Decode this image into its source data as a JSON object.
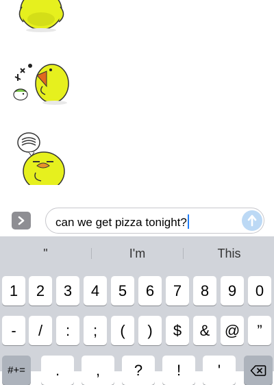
{
  "composer": {
    "message_text": "can we get pizza tonight?"
  },
  "predictions": [
    "\"",
    "I'm",
    "This"
  ],
  "keyboard": {
    "number_row": [
      "1",
      "2",
      "3",
      "4",
      "5",
      "6",
      "7",
      "8",
      "9",
      "0"
    ],
    "symbol_row": [
      "-",
      "/",
      ":",
      ";",
      "(",
      ")",
      "$",
      "&",
      "@",
      "”"
    ],
    "bottom_row": [
      "#+=",
      ".",
      ",",
      "?",
      "!",
      "'"
    ]
  },
  "icons": {
    "apps": "chevron-right-icon",
    "send": "send-arrow-icon",
    "delete": "backspace-icon"
  },
  "colors": {
    "sticker_yellow": "#e6f01e",
    "keyboard_bg": "#d1d4da",
    "caret": "#1f7cf6",
    "send_button": "#bcd9f5"
  }
}
